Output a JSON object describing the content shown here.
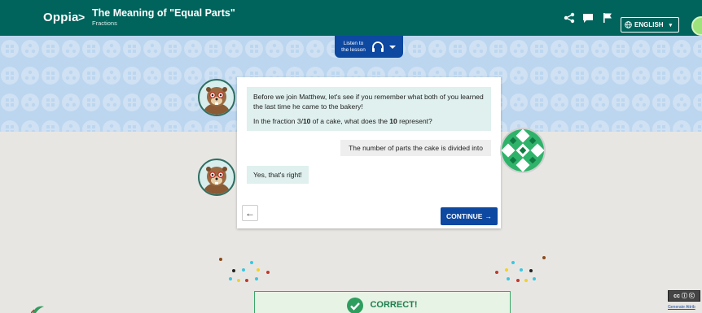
{
  "header": {
    "logo": "Oppia",
    "separator": ">",
    "title": "The Meaning of \"Equal Parts\"",
    "subtitle": "Fractions",
    "language_label": "ENGLISH",
    "icons": [
      "share-icon",
      "feedback-icon",
      "flag-icon",
      "globe-icon"
    ]
  },
  "audio": {
    "listen_label": "Listen to the lesson"
  },
  "conversation": {
    "question_paragraph_1": "Before we join Matthew, let's see if you remember what both of you learned the last time he came to the bakery!",
    "question_prefix": "In the fraction 3/",
    "question_bold_1": "10",
    "question_middle": " of a cake, what does the ",
    "question_bold_2": "10",
    "question_suffix": " represent?",
    "learner_answer": "The number of parts the cake is divided into",
    "feedback": "Yes, that's right!"
  },
  "navigation": {
    "back_label": "←",
    "continue_label": "CONTINUE",
    "continue_arrow": "→"
  },
  "result": {
    "label": "CORRECT!"
  },
  "license": {
    "badge": "cc ⓘ ⓒ",
    "attribution_link": "Generate Attrib"
  },
  "colors": {
    "header_bg": "#00645c",
    "accent_blue": "#0d48a1",
    "bubble_bg": "#dff0ee",
    "correct_green": "#1e7e4e"
  }
}
